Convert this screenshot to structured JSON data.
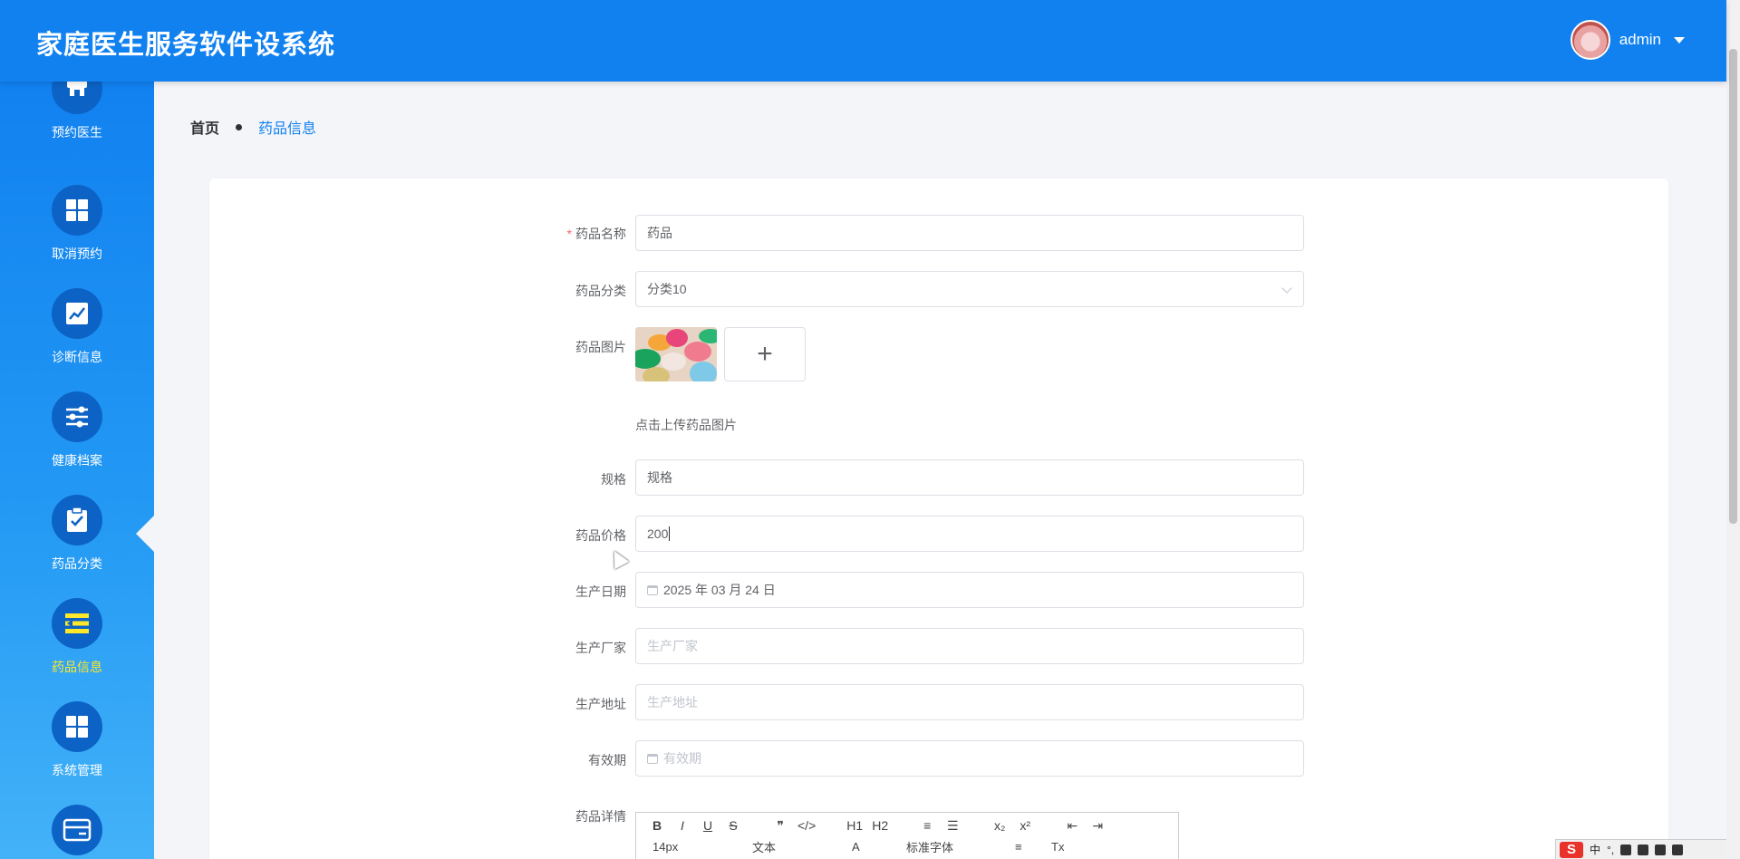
{
  "header": {
    "title": "家庭医生服务软件设系统",
    "username": "admin"
  },
  "sidebar": {
    "items": [
      {
        "label": "预约医生",
        "icon": "store-icon"
      },
      {
        "label": "取消预约",
        "icon": "grid-icon"
      },
      {
        "label": "诊断信息",
        "icon": "chart-icon"
      },
      {
        "label": "健康档案",
        "icon": "sliders-icon"
      },
      {
        "label": "药品分类",
        "icon": "clipboard-check-icon"
      },
      {
        "label": "药品信息",
        "icon": "list-icon",
        "active": true
      },
      {
        "label": "系统管理",
        "icon": "grid-icon"
      },
      {
        "label": "",
        "icon": "card-icon"
      }
    ],
    "active_color": "#ffe829"
  },
  "breadcrumb": {
    "home": "首页",
    "current": "药品信息"
  },
  "form": {
    "name": {
      "label": "药品名称",
      "value": "药品",
      "required": true
    },
    "category": {
      "label": "药品分类",
      "value": "分类10"
    },
    "image": {
      "label": "药品图片",
      "upload_tip": "点击上传药品图片",
      "plus": "+"
    },
    "spec": {
      "label": "规格",
      "value": "规格"
    },
    "price": {
      "label": "药品价格",
      "value": "200"
    },
    "production_date": {
      "label": "生产日期",
      "value": "2025 年 03 月 24 日"
    },
    "manufacturer": {
      "label": "生产厂家",
      "placeholder": "生产厂家"
    },
    "address": {
      "label": "生产地址",
      "placeholder": "生产地址"
    },
    "expiry": {
      "label": "有效期",
      "placeholder": "有效期"
    },
    "details": {
      "label": "药品详情"
    }
  },
  "editor": {
    "toolbar1": [
      "B",
      "I",
      "U",
      "S",
      "❞",
      "</>",
      "H1",
      "H2",
      "≡",
      "☰",
      "x₂",
      "x²",
      "⇤",
      "⇥"
    ],
    "font_size": "14px",
    "heading": "文本",
    "font_family": "标准字体",
    "clear": "Tx"
  },
  "ime": {
    "logo": "S",
    "mode": "中",
    "punct": "°,"
  },
  "colors": {
    "primary": "#1181f0",
    "required": "#f56c6c",
    "sidebar_circle": "#0c63c5"
  }
}
